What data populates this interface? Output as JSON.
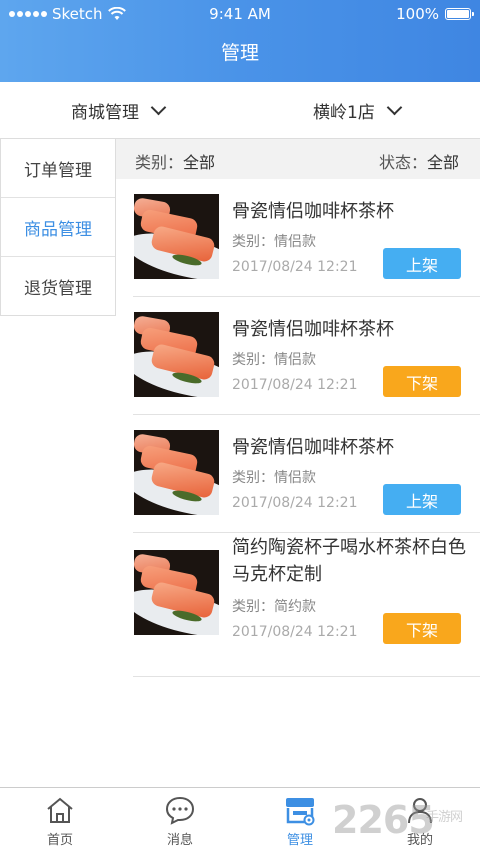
{
  "status_bar": {
    "carrier": "Sketch",
    "time": "9:41 AM",
    "battery": "100%"
  },
  "header": {
    "title": "管理"
  },
  "filters": [
    {
      "label": "商城管理"
    },
    {
      "label": "横岭1店"
    }
  ],
  "sidebar": {
    "items": [
      {
        "label": "订单管理"
      },
      {
        "label": "商品管理"
      },
      {
        "label": "退货管理"
      }
    ],
    "active_index": 1
  },
  "subbar": {
    "category_label": "类别：",
    "category_value": "全部",
    "status_label": "状态：",
    "status_value": "全部"
  },
  "products": [
    {
      "name": "骨瓷情侣咖啡杯茶杯",
      "category": "类别：情侣款",
      "date": "2017/08/24 12:21",
      "action": "上架"
    },
    {
      "name": "骨瓷情侣咖啡杯茶杯",
      "category": "类别：情侣款",
      "date": "2017/08/24 12:21",
      "action": "下架"
    },
    {
      "name": "骨瓷情侣咖啡杯茶杯",
      "category": "类别：情侣款",
      "date": "2017/08/24 12:21",
      "action": "上架"
    },
    {
      "name": "简约陶瓷杯子喝水杯茶杯白色马克杯定制",
      "category": "类别：简约款",
      "date": "2017/08/24 12:21",
      "action": "下架"
    }
  ],
  "tabbar": {
    "items": [
      {
        "label": "首页",
        "icon": "home-icon"
      },
      {
        "label": "消息",
        "icon": "message-icon"
      },
      {
        "label": "管理",
        "icon": "store-manage-icon"
      },
      {
        "label": "我的",
        "icon": "profile-icon"
      }
    ],
    "active_index": 2
  },
  "watermark": {
    "text": "2265",
    "sub": "手游网"
  },
  "colors": {
    "accent": "#3d8fe3",
    "up_button": "#45aef2",
    "down_button": "#f9a71c"
  }
}
